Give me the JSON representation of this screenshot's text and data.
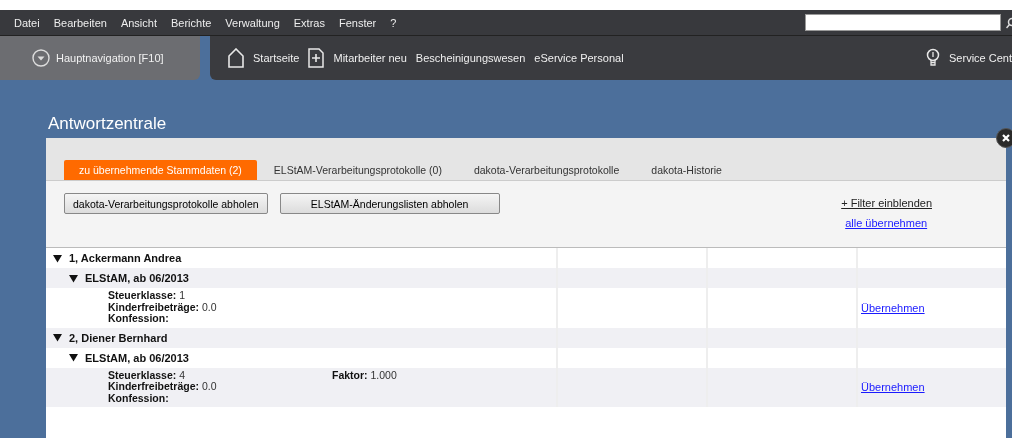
{
  "menu": [
    "Datei",
    "Bearbeiten",
    "Ansicht",
    "Berichte",
    "Verwaltung",
    "Extras",
    "Fenster",
    "?"
  ],
  "navigation": {
    "main_button": "Hauptnavigation [F10]",
    "items": [
      {
        "kind": "home",
        "label": "Startseite"
      },
      {
        "kind": "new",
        "label": "Mitarbeiter neu"
      },
      {
        "kind": "text",
        "label": "Bescheinigungswesen"
      },
      {
        "kind": "text",
        "label": "eService Personal"
      }
    ],
    "service": "Service Cent"
  },
  "dialog": {
    "title": "Antwortzentrale",
    "tabs": [
      {
        "label": "zu übernehmende Stammdaten (2)",
        "selected": true
      },
      {
        "label": "ELStAM-Verarbeitungsprotokolle (0)",
        "selected": false
      },
      {
        "label": "dakota-Verarbeitungsprotokolle",
        "selected": false
      },
      {
        "label": "dakota-Historie",
        "selected": false
      }
    ],
    "buttons": [
      "dakota-Verarbeitungsprotokolle abholen",
      "ELStAM-Änderungslisten abholen"
    ],
    "links": [
      "+ Filter einblenden",
      "alle übernehmen"
    ],
    "entries": [
      {
        "label": "1, Ackermann Andrea",
        "expanded": true,
        "children": [
          {
            "label": "ELStAM, ab 06/2013",
            "expanded": true,
            "fields": [
              {
                "label": "Steuerklasse:",
                "value": "1"
              },
              {
                "label": "Kinderfreibeträge:",
                "value": "0.0"
              },
              {
                "label": "Konfession:"
              }
            ],
            "action": "Übernehmen"
          }
        ]
      },
      {
        "label": "2, Diener Bernhard",
        "expanded": true,
        "children": [
          {
            "label": "ELStAM, ab 06/2013",
            "expanded": true,
            "fields": [
              {
                "label": "Steuerklasse:",
                "value": "4"
              },
              {
                "label": "Kinderfreibeträge:",
                "value": "0.0"
              },
              {
                "label": "Konfession:"
              }
            ],
            "extra_fields": [
              {
                "label": "Faktor:",
                "value": "1.000"
              }
            ],
            "action": "Übernehmen"
          }
        ]
      }
    ]
  }
}
